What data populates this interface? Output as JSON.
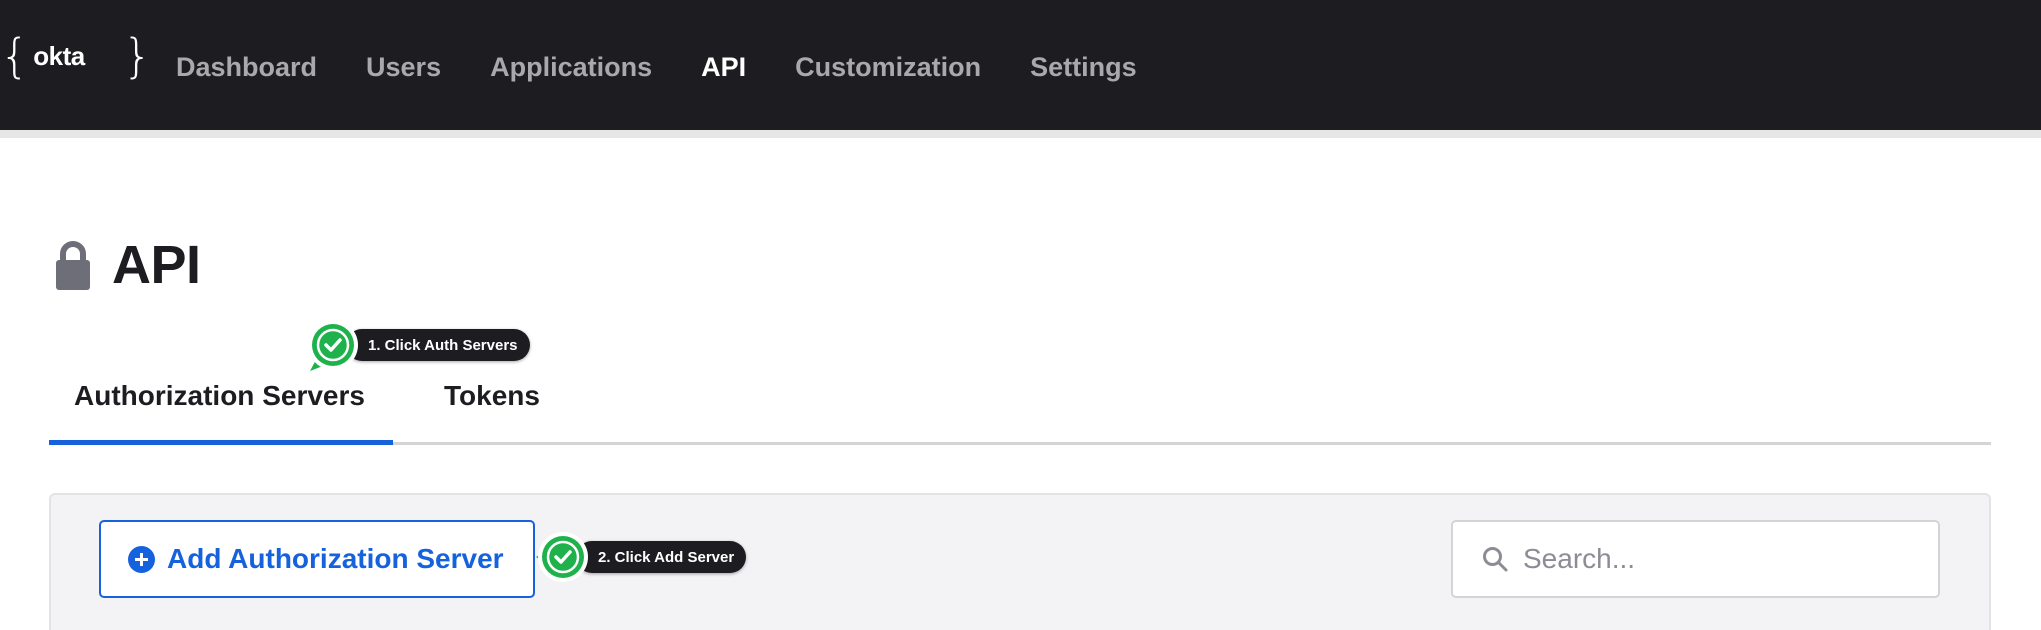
{
  "app": {
    "logo_text": "okta",
    "accent_color": "#1662dd",
    "topbar_color": "#1d1d21"
  },
  "nav": {
    "items": [
      {
        "label": "Dashboard",
        "active": false
      },
      {
        "label": "Users",
        "active": false
      },
      {
        "label": "Applications",
        "active": false
      },
      {
        "label": "API",
        "active": true
      },
      {
        "label": "Customization",
        "active": false
      },
      {
        "label": "Settings",
        "active": false
      }
    ]
  },
  "page": {
    "title": "API",
    "title_icon": "lock-icon"
  },
  "tabs": [
    {
      "label": "Authorization Servers",
      "active": true
    },
    {
      "label": "Tokens",
      "active": false
    }
  ],
  "toolbar": {
    "add_label": "Add Authorization Server",
    "add_icon": "plus-circle-icon",
    "search_placeholder": "Search...",
    "search_value": ""
  },
  "callouts": [
    {
      "text": "1. Click Auth Servers",
      "icon": "check-icon",
      "color": "#1fb24c"
    },
    {
      "text": "2. Click Add Server",
      "icon": "check-icon",
      "color": "#1fb24c"
    }
  ]
}
